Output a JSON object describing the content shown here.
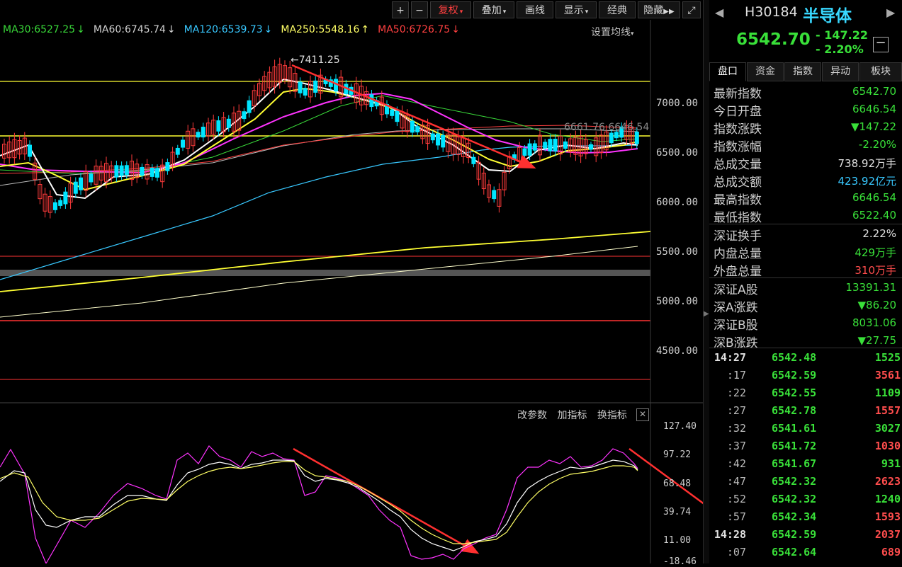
{
  "toolbar": {
    "buttons": [
      "+",
      "−",
      "复权",
      "叠加",
      "画线",
      "显示",
      "经典",
      "隐藏"
    ],
    "fuquan": "复权",
    "diejia": "叠加",
    "huaxian": "画线",
    "xianshi": "显示",
    "jingdian": "经典",
    "yincang": "隐藏"
  },
  "ma_legend": [
    {
      "text": "MA30:6527.25",
      "arrow": "↓",
      "color": "#39d839"
    },
    {
      "text": "MA60:6745.74",
      "arrow": "↓",
      "color": "#d0d0d0"
    },
    {
      "text": "MA120:6539.73",
      "arrow": "↓",
      "color": "#38c8ff"
    },
    {
      "text": "MA250:5548.16",
      "arrow": "↑",
      "color": "#ffff66"
    },
    {
      "text": "MA50:6726.75",
      "arrow": "↓",
      "color": "#ff4040"
    }
  ],
  "set_ma_label": "设置均线",
  "price_axis": [
    "7000.00",
    "6500.00",
    "6000.00",
    "5500.00",
    "5000.00",
    "4500.00"
  ],
  "annotations": {
    "high_label": "7411.25",
    "right_labels": "6661.76  6646.54"
  },
  "indicator": {
    "controls": [
      "改参数",
      "加指标",
      "换指标"
    ],
    "axis": [
      "127.40",
      "97.22",
      "68.48",
      "39.74",
      "11.00",
      "-18.46"
    ]
  },
  "quote": {
    "code": "H30184",
    "name": "半导体",
    "price": "6542.70",
    "change": "- 147.22",
    "change_pct": "- 2.20%",
    "tabs": [
      "盘口",
      "资金",
      "指数",
      "异动",
      "板块"
    ],
    "stats": [
      {
        "label": "最新指数",
        "value": "6542.70",
        "color": "#39e039"
      },
      {
        "label": "今日开盘",
        "value": "6646.54",
        "color": "#39e039"
      },
      {
        "label": "指数涨跌",
        "value": "▼147.22",
        "color": "#39e039"
      },
      {
        "label": "指数涨幅",
        "value": "-2.20%",
        "color": "#39e039"
      },
      {
        "label": "总成交量",
        "value": "738.92万手",
        "color": "#e0e0e0"
      },
      {
        "label": "总成交额",
        "value": "423.92亿元",
        "color": "#38c8ff"
      },
      {
        "label": "最高指数",
        "value": "6646.54",
        "color": "#39e039"
      },
      {
        "label": "最低指数",
        "value": "6522.40",
        "color": "#39e039"
      },
      {
        "label": "深证换手",
        "value": "2.22%",
        "color": "#e0e0e0"
      },
      {
        "label": "内盘总量",
        "value": "429万手",
        "color": "#39e039"
      },
      {
        "label": "外盘总量",
        "value": "310万手",
        "color": "#ff4d4d"
      },
      {
        "label": "深证A股",
        "value": "13391.31",
        "color": "#39e039"
      },
      {
        "label": "深A涨跌",
        "value": "▼86.20",
        "color": "#39e039"
      },
      {
        "label": "深证B股",
        "value": "8031.06",
        "color": "#39e039"
      },
      {
        "label": "深B涨跌",
        "value": "▼27.75",
        "color": "#39e039"
      }
    ],
    "ticks": [
      {
        "time": "14:27",
        "price": "6542.48",
        "vol": "1525",
        "color": "#39e039"
      },
      {
        "time": ":17",
        "price": "6542.59",
        "vol": "3561",
        "color": "#ff4d4d"
      },
      {
        "time": ":22",
        "price": "6542.55",
        "vol": "1109",
        "color": "#39e039"
      },
      {
        "time": ":27",
        "price": "6542.78",
        "vol": "1557",
        "color": "#ff4d4d"
      },
      {
        "time": ":32",
        "price": "6541.61",
        "vol": "3027",
        "color": "#39e039"
      },
      {
        "time": ":37",
        "price": "6541.72",
        "vol": "1030",
        "color": "#ff4d4d"
      },
      {
        "time": ":42",
        "price": "6541.67",
        "vol": "931",
        "color": "#39e039"
      },
      {
        "time": ":47",
        "price": "6542.32",
        "vol": "2623",
        "color": "#ff4d4d"
      },
      {
        "time": ":52",
        "price": "6542.32",
        "vol": "1240",
        "color": "#39e039"
      },
      {
        "time": ":57",
        "price": "6542.34",
        "vol": "1593",
        "color": "#ff4d4d"
      },
      {
        "time": "14:28",
        "price": "6542.59",
        "vol": "2037",
        "color": "#ff4d4d"
      },
      {
        "time": ":07",
        "price": "6542.64",
        "vol": "689",
        "color": "#ff4d4d"
      }
    ]
  }
}
